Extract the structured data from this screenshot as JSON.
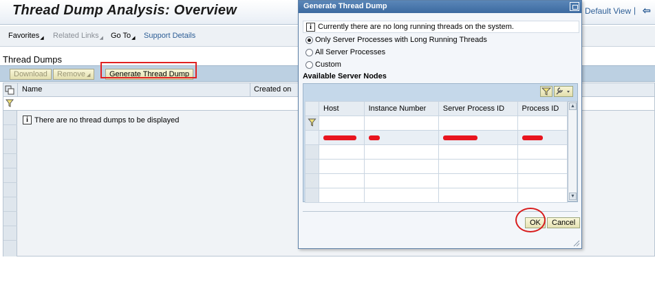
{
  "page": {
    "title": "Thread Dump Analysis: Overview",
    "default_view": "Default View",
    "separator": "|"
  },
  "menu": {
    "favorites": "Favorites",
    "related_links": "Related Links",
    "go_to": "Go To",
    "support_details": "Support Details"
  },
  "section": {
    "title": "Thread Dumps"
  },
  "toolbar": {
    "download": "Download",
    "remove": "Remove",
    "generate": "Generate Thread Dump"
  },
  "grid": {
    "columns": [
      "Name",
      "Created on"
    ],
    "empty_message": "There are no thread dumps to be displayed"
  },
  "dialog": {
    "title": "Generate Thread Dump",
    "message": "Currently there are no long running threads on the system.",
    "options": [
      "Only Server Processes with Long Running Threads",
      "All Server Processes",
      "Custom"
    ],
    "selected_option": 0,
    "nodes_heading": "Available Server Nodes",
    "columns": [
      "Host",
      "Instance Number",
      "Server Process ID",
      "Process ID"
    ],
    "ok": "OK",
    "cancel": "Cancel"
  },
  "colors": {
    "accent": "#2c5d95",
    "dialog_title": "#3c6aa0",
    "highlight": "#e02020",
    "redaction": "#e8141e"
  }
}
